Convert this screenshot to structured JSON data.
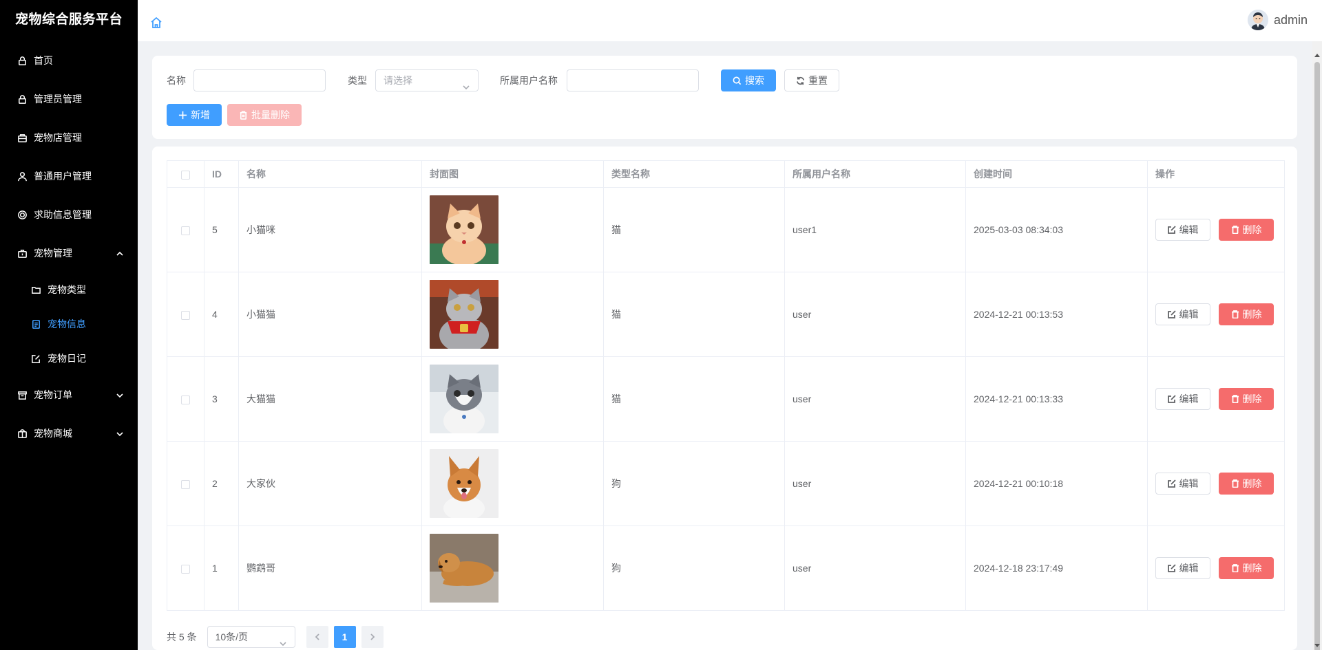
{
  "app": {
    "brand": "宠物综合服务平台"
  },
  "header": {
    "username": "admin"
  },
  "sidebar": {
    "items": [
      {
        "label": "首页",
        "icon": "lock-icon"
      },
      {
        "label": "管理员管理",
        "icon": "lock-icon"
      },
      {
        "label": "宠物店管理",
        "icon": "shop-icon"
      },
      {
        "label": "普通用户管理",
        "icon": "user-icon"
      },
      {
        "label": "求助信息管理",
        "icon": "help-icon"
      },
      {
        "label": "宠物管理",
        "icon": "suitcase-icon",
        "expanded": true,
        "children": [
          {
            "label": "宠物类型",
            "icon": "folder-icon"
          },
          {
            "label": "宠物信息",
            "icon": "document-icon",
            "active": true
          },
          {
            "label": "宠物日记",
            "icon": "edit-icon"
          }
        ]
      },
      {
        "label": "宠物订单",
        "icon": "box-icon",
        "expanded": false
      },
      {
        "label": "宠物商城",
        "icon": "shopping-bag-icon",
        "expanded": false
      }
    ]
  },
  "search": {
    "name_label": "名称",
    "name_value": "",
    "type_label": "类型",
    "type_placeholder": "请选择",
    "owner_label": "所属用户名称",
    "owner_value": "",
    "search_button": "搜索",
    "reset_button": "重置",
    "add_button": "新增",
    "batch_delete_button": "批量删除"
  },
  "table": {
    "columns": [
      "ID",
      "名称",
      "封面图",
      "类型名称",
      "所属用户名称",
      "创建时间",
      "操作"
    ],
    "edit_label": "编辑",
    "delete_label": "删除",
    "rows": [
      {
        "id": "5",
        "name": "小猫咪",
        "type": "猫",
        "owner": "user1",
        "created": "2025-03-03 08:34:03",
        "cover": "orange-cat"
      },
      {
        "id": "4",
        "name": "小猫猫",
        "type": "猫",
        "owner": "user",
        "created": "2024-12-21 00:13:53",
        "cover": "gray-cat-red-scarf"
      },
      {
        "id": "3",
        "name": "大猫猫",
        "type": "猫",
        "owner": "user",
        "created": "2024-12-21 00:13:33",
        "cover": "gray-white-kitten"
      },
      {
        "id": "2",
        "name": "大家伙",
        "type": "狗",
        "owner": "user",
        "created": "2024-12-21 00:10:18",
        "cover": "corgi"
      },
      {
        "id": "1",
        "name": "鹦鹉哥",
        "type": "狗",
        "owner": "user",
        "created": "2024-12-18 23:17:49",
        "cover": "golden-retriever"
      }
    ]
  },
  "pagination": {
    "total_text": "共 5 条",
    "page_size": "10条/页",
    "current_page": "1"
  },
  "colors": {
    "primary": "#409eff",
    "danger": "#f56c6c",
    "sidebar_bg": "#000000"
  }
}
